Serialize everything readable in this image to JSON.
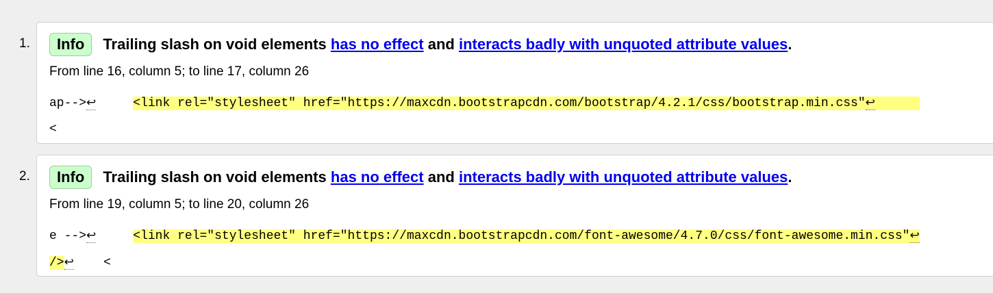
{
  "messages": [
    {
      "number": "1.",
      "badge": "Info",
      "message_pre": "Trailing slash on void elements",
      "link1": "has no effect",
      "message_mid": "and",
      "link2": "interacts badly with unquoted attribute values",
      "message_end": ".",
      "location": "From line 16, column 5; to line 17, column 26",
      "extract_start": "ap-->",
      "extract_gap": "     ",
      "extract_highlight": "<link rel=\"stylesheet\" href=\"https://maxcdn.bootstrapcdn.com/bootstrap/4.2.1/css/bootstrap.min.css\"",
      "extract_trail": "      ",
      "extract_line2": "<"
    },
    {
      "number": "2.",
      "badge": "Info",
      "message_pre": "Trailing slash on void elements",
      "link1": "has no effect",
      "message_mid": "and",
      "link2": "interacts badly with unquoted attribute values",
      "message_end": ".",
      "location": "From line 19, column 5; to line 20, column 26",
      "extract_start": "e -->",
      "extract_gap": "     ",
      "extract_highlight": "<link rel=\"stylesheet\" href=\"https://maxcdn.bootstrapcdn.com/font-awesome/4.7.0/css/font-awesome.min.css\"",
      "extract_line2_highlight": "/>",
      "extract_line2_gap": "    ",
      "extract_line2_rest": "<"
    }
  ],
  "glyphs": {
    "line_break": "↩"
  },
  "colors": {
    "badge_bg": "#ccffcc",
    "highlight": "#ffff80",
    "link": "#0000ee",
    "page_bg": "#efefef"
  }
}
